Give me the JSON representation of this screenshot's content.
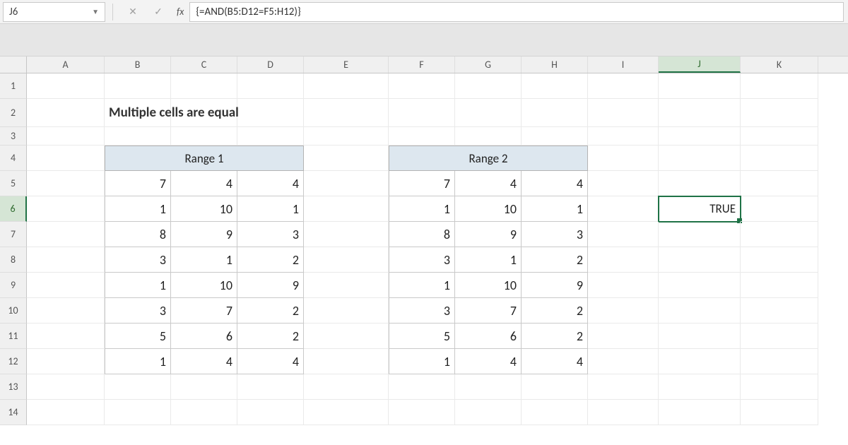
{
  "namebox": "J6",
  "formula": "{=AND(B5:D12=F5:H12)}",
  "title": "Multiple cells are equal",
  "columns": [
    "A",
    "B",
    "C",
    "D",
    "E",
    "F",
    "G",
    "H",
    "I",
    "J",
    "K"
  ],
  "rows": [
    "1",
    "2",
    "3",
    "4",
    "5",
    "6",
    "7",
    "8",
    "9",
    "10",
    "11",
    "12",
    "13",
    "14"
  ],
  "active_col": "J",
  "active_row": "6",
  "range1_label": "Range 1",
  "range2_label": "Range 2",
  "data_rows": [
    {
      "r1": [
        7,
        4,
        4
      ],
      "r2": [
        7,
        4,
        4
      ]
    },
    {
      "r1": [
        1,
        10,
        1
      ],
      "r2": [
        1,
        10,
        1
      ]
    },
    {
      "r1": [
        8,
        9,
        3
      ],
      "r2": [
        8,
        9,
        3
      ]
    },
    {
      "r1": [
        3,
        1,
        2
      ],
      "r2": [
        3,
        1,
        2
      ]
    },
    {
      "r1": [
        1,
        10,
        9
      ],
      "r2": [
        1,
        10,
        9
      ]
    },
    {
      "r1": [
        3,
        7,
        2
      ],
      "r2": [
        3,
        7,
        2
      ]
    },
    {
      "r1": [
        5,
        6,
        2
      ],
      "r2": [
        5,
        6,
        2
      ]
    },
    {
      "r1": [
        1,
        4,
        4
      ],
      "r2": [
        1,
        4,
        4
      ]
    }
  ],
  "result_cell": "TRUE",
  "chart_data": {
    "type": "table",
    "title": "Multiple cells are equal",
    "tables": [
      {
        "name": "Range 1",
        "columns": [
          "B",
          "C",
          "D"
        ],
        "rows": [
          [
            7,
            4,
            4
          ],
          [
            1,
            10,
            1
          ],
          [
            8,
            9,
            3
          ],
          [
            3,
            1,
            2
          ],
          [
            1,
            10,
            9
          ],
          [
            3,
            7,
            2
          ],
          [
            5,
            6,
            2
          ],
          [
            1,
            4,
            4
          ]
        ]
      },
      {
        "name": "Range 2",
        "columns": [
          "F",
          "G",
          "H"
        ],
        "rows": [
          [
            7,
            4,
            4
          ],
          [
            1,
            10,
            1
          ],
          [
            8,
            9,
            3
          ],
          [
            3,
            1,
            2
          ],
          [
            1,
            10,
            9
          ],
          [
            3,
            7,
            2
          ],
          [
            5,
            6,
            2
          ],
          [
            1,
            4,
            4
          ]
        ]
      }
    ],
    "formula": "{=AND(B5:D12=F5:H12)}",
    "result": "TRUE"
  }
}
